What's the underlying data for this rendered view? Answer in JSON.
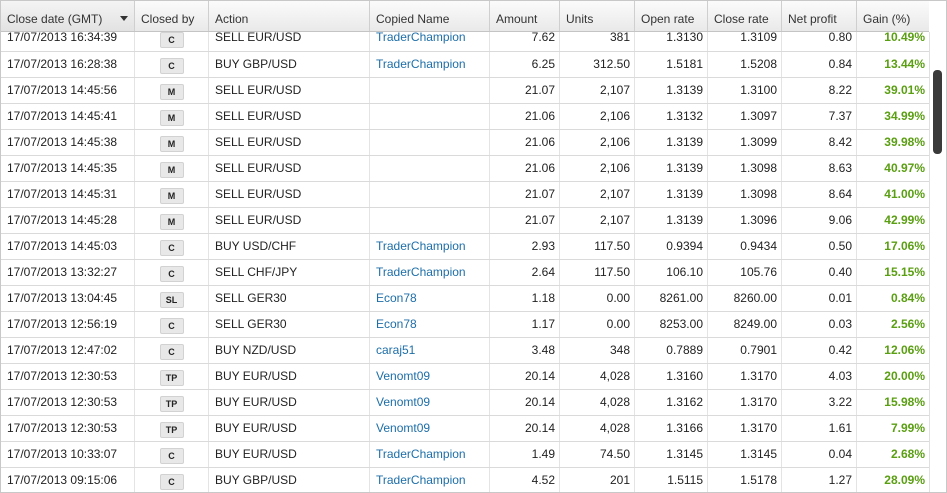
{
  "columns": {
    "close_date": "Close date (GMT)",
    "closed_by": "Closed by",
    "action": "Action",
    "copied_name": "Copied Name",
    "amount": "Amount",
    "units": "Units",
    "open_rate": "Open rate",
    "close_rate": "Close rate",
    "net_profit": "Net profit",
    "gain": "Gain (%)"
  },
  "rows": [
    {
      "date": "17/07/2013 16:34:39",
      "closed_by": "C",
      "action": "SELL EUR/USD",
      "copied": "TraderChampion",
      "amount": "7.62",
      "units": "381",
      "open": "1.3130",
      "close": "1.3109",
      "profit": "0.80",
      "gain": "10.49%"
    },
    {
      "date": "17/07/2013 16:28:38",
      "closed_by": "C",
      "action": "BUY GBP/USD",
      "copied": "TraderChampion",
      "amount": "6.25",
      "units": "312.50",
      "open": "1.5181",
      "close": "1.5208",
      "profit": "0.84",
      "gain": "13.44%"
    },
    {
      "date": "17/07/2013 14:45:56",
      "closed_by": "M",
      "action": "SELL EUR/USD",
      "copied": "",
      "amount": "21.07",
      "units": "2,107",
      "open": "1.3139",
      "close": "1.3100",
      "profit": "8.22",
      "gain": "39.01%"
    },
    {
      "date": "17/07/2013 14:45:41",
      "closed_by": "M",
      "action": "SELL EUR/USD",
      "copied": "",
      "amount": "21.06",
      "units": "2,106",
      "open": "1.3132",
      "close": "1.3097",
      "profit": "7.37",
      "gain": "34.99%"
    },
    {
      "date": "17/07/2013 14:45:38",
      "closed_by": "M",
      "action": "SELL EUR/USD",
      "copied": "",
      "amount": "21.06",
      "units": "2,106",
      "open": "1.3139",
      "close": "1.3099",
      "profit": "8.42",
      "gain": "39.98%"
    },
    {
      "date": "17/07/2013 14:45:35",
      "closed_by": "M",
      "action": "SELL EUR/USD",
      "copied": "",
      "amount": "21.06",
      "units": "2,106",
      "open": "1.3139",
      "close": "1.3098",
      "profit": "8.63",
      "gain": "40.97%"
    },
    {
      "date": "17/07/2013 14:45:31",
      "closed_by": "M",
      "action": "SELL EUR/USD",
      "copied": "",
      "amount": "21.07",
      "units": "2,107",
      "open": "1.3139",
      "close": "1.3098",
      "profit": "8.64",
      "gain": "41.00%"
    },
    {
      "date": "17/07/2013 14:45:28",
      "closed_by": "M",
      "action": "SELL EUR/USD",
      "copied": "",
      "amount": "21.07",
      "units": "2,107",
      "open": "1.3139",
      "close": "1.3096",
      "profit": "9.06",
      "gain": "42.99%"
    },
    {
      "date": "17/07/2013 14:45:03",
      "closed_by": "C",
      "action": "BUY USD/CHF",
      "copied": "TraderChampion",
      "amount": "2.93",
      "units": "117.50",
      "open": "0.9394",
      "close": "0.9434",
      "profit": "0.50",
      "gain": "17.06%"
    },
    {
      "date": "17/07/2013 13:32:27",
      "closed_by": "C",
      "action": "SELL CHF/JPY",
      "copied": "TraderChampion",
      "amount": "2.64",
      "units": "117.50",
      "open": "106.10",
      "close": "105.76",
      "profit": "0.40",
      "gain": "15.15%"
    },
    {
      "date": "17/07/2013 13:04:45",
      "closed_by": "SL",
      "action": "SELL GER30",
      "copied": "Econ78",
      "amount": "1.18",
      "units": "0.00",
      "open": "8261.00",
      "close": "8260.00",
      "profit": "0.01",
      "gain": "0.84%"
    },
    {
      "date": "17/07/2013 12:56:19",
      "closed_by": "C",
      "action": "SELL GER30",
      "copied": "Econ78",
      "amount": "1.17",
      "units": "0.00",
      "open": "8253.00",
      "close": "8249.00",
      "profit": "0.03",
      "gain": "2.56%"
    },
    {
      "date": "17/07/2013 12:47:02",
      "closed_by": "C",
      "action": "BUY NZD/USD",
      "copied": "caraj51",
      "amount": "3.48",
      "units": "348",
      "open": "0.7889",
      "close": "0.7901",
      "profit": "0.42",
      "gain": "12.06%"
    },
    {
      "date": "17/07/2013 12:30:53",
      "closed_by": "TP",
      "action": "BUY EUR/USD",
      "copied": "Venomt09",
      "amount": "20.14",
      "units": "4,028",
      "open": "1.3160",
      "close": "1.3170",
      "profit": "4.03",
      "gain": "20.00%"
    },
    {
      "date": "17/07/2013 12:30:53",
      "closed_by": "TP",
      "action": "BUY EUR/USD",
      "copied": "Venomt09",
      "amount": "20.14",
      "units": "4,028",
      "open": "1.3162",
      "close": "1.3170",
      "profit": "3.22",
      "gain": "15.98%"
    },
    {
      "date": "17/07/2013 12:30:53",
      "closed_by": "TP",
      "action": "BUY EUR/USD",
      "copied": "Venomt09",
      "amount": "20.14",
      "units": "4,028",
      "open": "1.3166",
      "close": "1.3170",
      "profit": "1.61",
      "gain": "7.99%"
    },
    {
      "date": "17/07/2013 10:33:07",
      "closed_by": "C",
      "action": "BUY EUR/USD",
      "copied": "TraderChampion",
      "amount": "1.49",
      "units": "74.50",
      "open": "1.3145",
      "close": "1.3145",
      "profit": "0.04",
      "gain": "2.68%"
    },
    {
      "date": "17/07/2013 09:15:06",
      "closed_by": "C",
      "action": "BUY GBP/USD",
      "copied": "TraderChampion",
      "amount": "4.52",
      "units": "201",
      "open": "1.5115",
      "close": "1.5178",
      "profit": "1.27",
      "gain": "28.09%"
    }
  ],
  "colors": {
    "link": "#1d6ea8",
    "gain": "#5a9e12"
  }
}
